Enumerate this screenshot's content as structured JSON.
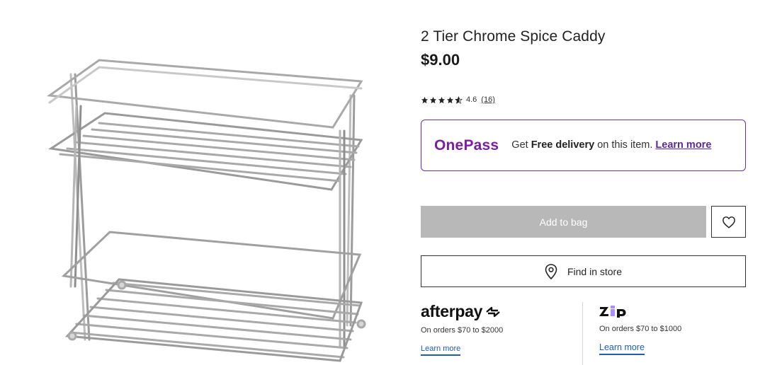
{
  "product": {
    "title": "2 Tier Chrome Spice Caddy",
    "price": "$9.00",
    "rating_value": "4.6",
    "rating_count": "(16)",
    "rating_stars": 4.6,
    "image_icon": "spice-caddy-image"
  },
  "onepass": {
    "logo": "OnePass",
    "text_prefix": "Get ",
    "text_bold": "Free delivery",
    "text_suffix": " on this item. ",
    "link": "Learn more",
    "accent": "#7a1fa2"
  },
  "actions": {
    "add_to_bag": "Add to bag",
    "find_in_store": "Find in store",
    "wishlist_icon": "heart-icon",
    "store_icon": "location-pin-icon"
  },
  "payments": {
    "afterpay": {
      "logo": "afterpay",
      "subtitle": "On orders $70 to $2000",
      "link": "Learn more"
    },
    "zip": {
      "logo": "zip",
      "subtitle": "On orders $70 to $1000",
      "link": "Learn more"
    }
  }
}
